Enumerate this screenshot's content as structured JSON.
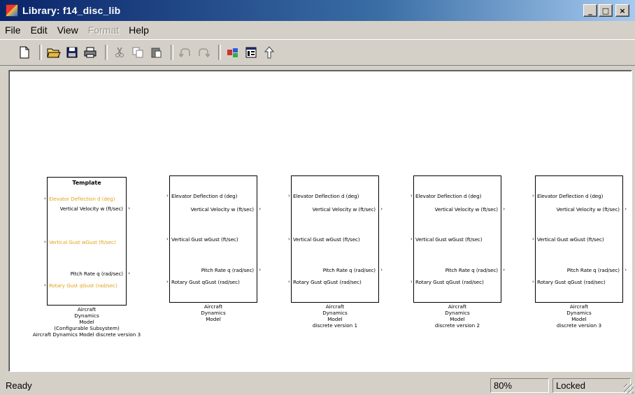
{
  "window": {
    "title": "Library: f14_disc_lib",
    "controls": [
      "_",
      "□",
      "×"
    ]
  },
  "menu": [
    {
      "label": "File",
      "disabled": false
    },
    {
      "label": "Edit",
      "disabled": false
    },
    {
      "label": "View",
      "disabled": false
    },
    {
      "label": "Format",
      "disabled": true
    },
    {
      "label": "Help",
      "disabled": false
    }
  ],
  "toolbar": [
    "new-icon",
    "open-icon",
    "save-icon",
    "print-icon",
    "cut-icon",
    "copy-icon",
    "paste-icon",
    "undo-icon",
    "redo-icon",
    "library-browser-icon",
    "model-explorer-icon",
    "go-to-parent-icon"
  ],
  "blocks": [
    {
      "title": "Template",
      "inputs": [
        "Elevator Deflection d (deg)",
        "Vertical Gust wGust (ft/sec)",
        "Rotary Gust qGust (rad/sec)"
      ],
      "outputs": [
        "Vertical Velocity w (ft/sec)",
        "Pitch Rate q (rad/sec)"
      ],
      "caption": [
        "Aircraft",
        "Dynamics",
        "Model",
        "(Configurable Subsystem)",
        "Aircraft Dynamics Model discrete version 3"
      ]
    },
    {
      "title": "",
      "inputs": [
        "Elevator Deflection d (deg)",
        "Vertical Gust wGust (ft/sec)",
        "Rotary Gust qGust (rad/sec)"
      ],
      "outputs": [
        "Vertical Velocity w (ft/sec)",
        "Pitch Rate q (rad/sec)"
      ],
      "caption": [
        "Aircraft",
        "Dynamics",
        "Model"
      ]
    },
    {
      "title": "",
      "inputs": [
        "Elevator Deflection d (deg)",
        "Vertical Gust wGust (ft/sec)",
        "Rotary Gust qGust (rad/sec)"
      ],
      "outputs": [
        "Vertical Velocity w (ft/sec)",
        "Pitch Rate q (rad/sec)"
      ],
      "caption": [
        "Aircraft",
        "Dynamics",
        "Model",
        "discrete version 1"
      ]
    },
    {
      "title": "",
      "inputs": [
        "Elevator Deflection d (deg)",
        "Vertical Gust wGust (ft/sec)",
        "Rotary Gust qGust (rad/sec)"
      ],
      "outputs": [
        "Vertical Velocity w (ft/sec)",
        "Pitch Rate q (rad/sec)"
      ],
      "caption": [
        "Aircraft",
        "Dynamics",
        "Model",
        "discrete version 2"
      ]
    },
    {
      "title": "",
      "inputs": [
        "Elevator Deflection d (deg)",
        "Vertical Gust wGust (ft/sec)",
        "Rotary Gust qGust (rad/sec)"
      ],
      "outputs": [
        "Vertical Velocity w (ft/sec)",
        "Pitch Rate q (rad/sec)"
      ],
      "caption": [
        "Aircraft",
        "Dynamics",
        "Model",
        "discrete version 3"
      ]
    }
  ],
  "status": {
    "text": "Ready",
    "zoom": "80%",
    "lock": "Locked"
  },
  "colors": {
    "template_port": "#e3a21a",
    "title_bar": "#0a246a"
  }
}
